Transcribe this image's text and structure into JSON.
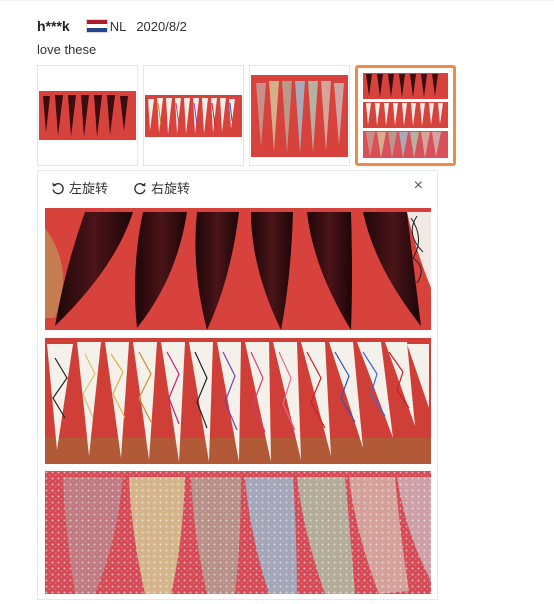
{
  "review": {
    "username": "h***k",
    "country": "NL",
    "date": "2020/8/2",
    "text": "love these"
  },
  "thumbnails": [
    {
      "name": "dark-nail-tips-thumbnail",
      "selected": false
    },
    {
      "name": "spider-gel-nail-tips-thumbnail",
      "selected": false
    },
    {
      "name": "glitter-nail-tips-thumbnail",
      "selected": false
    },
    {
      "name": "collage-nail-tips-thumbnail",
      "selected": true
    }
  ],
  "viewer": {
    "rotate_left_label": "左旋转",
    "rotate_right_label": "右旋转",
    "close_label": "×"
  },
  "colors": {
    "accent": "#ef8a4a",
    "background_red": "#d8423c"
  }
}
